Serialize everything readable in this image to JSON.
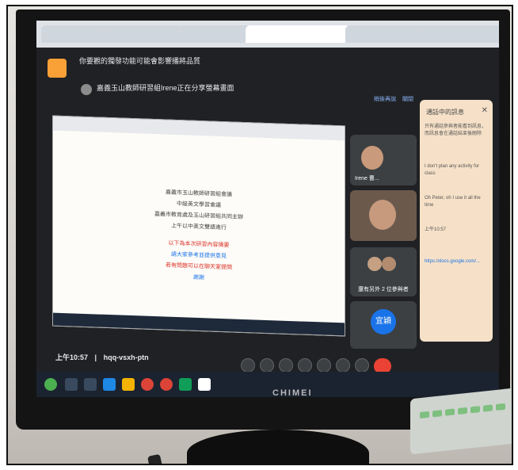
{
  "meet": {
    "notice_title": "你要觀的獨發功能可能會影響播將品質",
    "presenter_text": "嘉義玉山教師研習組Irene正在分享螢幕畫面",
    "link_left": "稍後再說",
    "link_right": "關閉",
    "tiles": {
      "tile1_name": "Irene 曹...",
      "tile3_name": "還有另外 2 位參與者",
      "tile4_name": "宜穎"
    },
    "side_panel_title": "通話中的訊息",
    "side_panel_lines": [
      "只有通話參與者能看到訊息，而訊息會在通話結束後刪除",
      "I don't plan any activity for class",
      "Oh Peter, oh I use it all the time",
      "上午10:57",
      "https://docs.google.com/..."
    ],
    "clock": "上午10:57",
    "meeting_code": "hqq-vsxh-ptn"
  },
  "shared_doc": {
    "lines": [
      "嘉義市玉山教師研習組會議",
      "中級英文學習會議",
      "嘉義市教育處及玉山研習組共同主辦",
      "上午以中英文雙語進行",
      "以下為本次研習內容摘要",
      "請大家參考並提供意見",
      "若有問題可以在聊天室提問",
      "謝謝"
    ]
  },
  "monitor": {
    "brand": "CHIMEI"
  },
  "colors": {
    "accent_orange": "#f9a037",
    "end_call_red": "#ea4335",
    "meet_bg": "#202124",
    "side_panel_bg": "#f6e1c8"
  }
}
